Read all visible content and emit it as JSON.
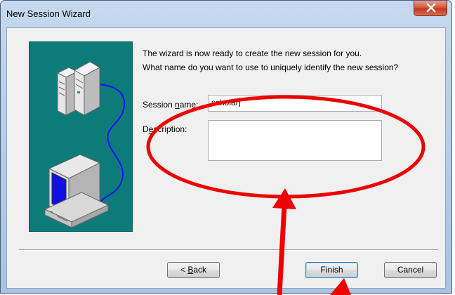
{
  "window": {
    "title": "New Session Wizard"
  },
  "intro": {
    "line1": "The wizard is now ready to create the new session for you.",
    "line2": "What name do you want to use to uniquely identify the new session?"
  },
  "form": {
    "session_name_label_pre": "Sess",
    "session_name_label_mid": "ion ",
    "session_name_label_u": "n",
    "session_name_label_post": "ame:",
    "session_name_value": "scholar",
    "description_label_pre": "D",
    "description_label_u": "e",
    "description_label_post": "scription:",
    "description_value": ""
  },
  "buttons": {
    "back_prefix": "< ",
    "back_u": "B",
    "back_rest": "ack",
    "finish": "Finish",
    "cancel": "Cancel"
  },
  "icons": [
    "close-icon",
    "server-tower-icon",
    "desktop-computer-icon",
    "network-cable-icon"
  ],
  "colors": {
    "illustration_bg": "#0e7b7b",
    "annotation_red": "#ee0000",
    "monitor_screen": "#1010e0"
  }
}
